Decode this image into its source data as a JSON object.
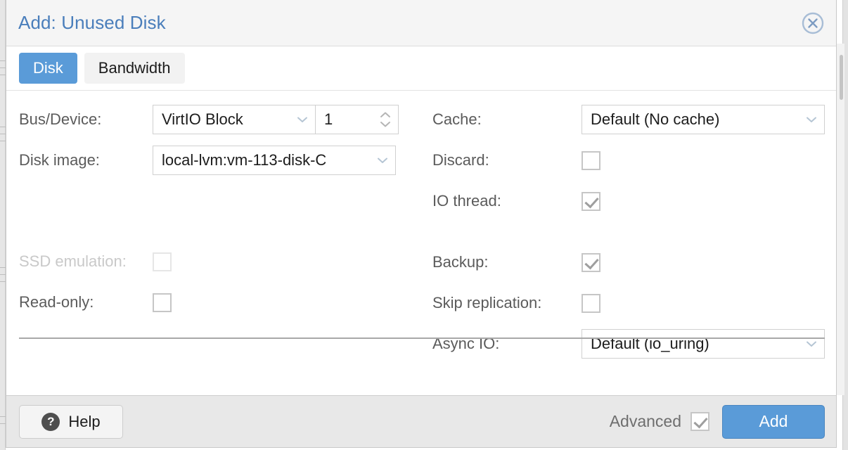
{
  "dialog": {
    "title": "Add: Unused Disk",
    "close_icon": "close-circle-icon"
  },
  "tabs": [
    {
      "label": "Disk",
      "active": true
    },
    {
      "label": "Bandwidth",
      "active": false
    }
  ],
  "form": {
    "left_column": {
      "bus_device": {
        "label": "Bus/Device:",
        "select_value": "VirtIO Block",
        "device_number": "1"
      },
      "disk_image": {
        "label": "Disk image:",
        "select_value": "local-lvm:vm-113-disk-C"
      },
      "ssd_emulation": {
        "label": "SSD emulation:",
        "checked": false,
        "disabled": true
      },
      "read_only": {
        "label": "Read-only:",
        "checked": false,
        "disabled": false
      }
    },
    "right_column": {
      "cache": {
        "label": "Cache:",
        "select_value": "Default (No cache)"
      },
      "discard": {
        "label": "Discard:",
        "checked": false
      },
      "io_thread": {
        "label": "IO thread:",
        "checked": true
      },
      "backup": {
        "label": "Backup:",
        "checked": true
      },
      "skip_replication": {
        "label": "Skip replication:",
        "checked": false
      },
      "async_io": {
        "label": "Async IO:",
        "select_value": "Default (io_uring)"
      }
    }
  },
  "footer": {
    "help_label": "Help",
    "help_icon": "question-mark-icon",
    "advanced_label": "Advanced",
    "advanced_checked": true,
    "add_label": "Add"
  },
  "colors": {
    "accent_blue": "#5a9bd8",
    "title_blue": "#4a7ebb",
    "header_bg": "#f5f5f5",
    "footer_bg": "#e8e8e8",
    "label_gray": "#5b5b5b",
    "disabled_gray": "#c9c9c9",
    "border_gray": "#d0d0d0"
  }
}
